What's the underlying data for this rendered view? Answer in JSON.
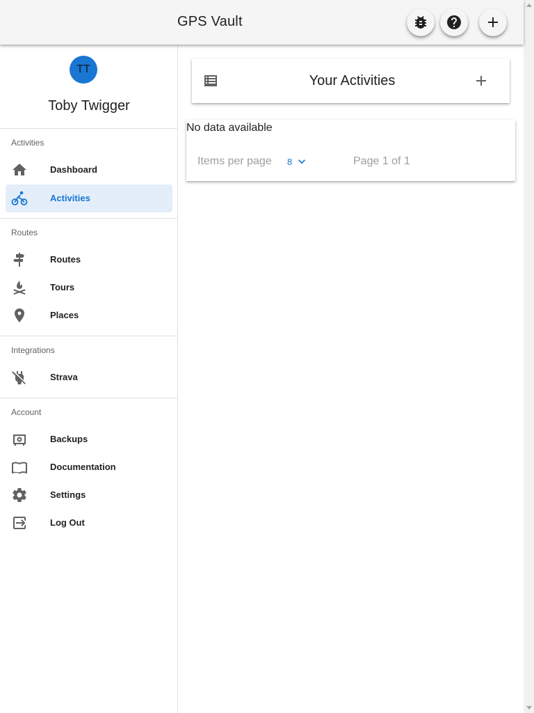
{
  "app": {
    "title": "GPS Vault"
  },
  "appbar": {
    "actions": [
      {
        "name": "bug-report-button",
        "icon": "bug-icon"
      },
      {
        "name": "help-button",
        "icon": "help-icon"
      },
      {
        "name": "add-button",
        "icon": "plus-icon"
      }
    ]
  },
  "user": {
    "initials": "TT",
    "name": "Toby Twigger"
  },
  "sidebar": {
    "sections": [
      {
        "title": "Activities",
        "items": [
          {
            "label": "Dashboard",
            "icon": "home-icon",
            "active": false
          },
          {
            "label": "Activities",
            "icon": "bike-icon",
            "active": true
          }
        ]
      },
      {
        "title": "Routes",
        "items": [
          {
            "label": "Routes",
            "icon": "signpost-icon",
            "active": false
          },
          {
            "label": "Tours",
            "icon": "campfire-icon",
            "active": false
          },
          {
            "label": "Places",
            "icon": "map-marker-icon",
            "active": false
          }
        ]
      },
      {
        "title": "Integrations",
        "items": [
          {
            "label": "Strava",
            "icon": "power-plug-off-icon",
            "active": false
          }
        ]
      },
      {
        "title": "Account",
        "items": [
          {
            "label": "Backups",
            "icon": "safe-icon",
            "active": false
          },
          {
            "label": "Documentation",
            "icon": "book-open-icon",
            "active": false
          },
          {
            "label": "Settings",
            "icon": "gear-icon",
            "active": false
          },
          {
            "label": "Log Out",
            "icon": "logout-icon",
            "active": false
          }
        ]
      }
    ]
  },
  "main": {
    "title": "Your Activities",
    "table": {
      "empty_text": "No data available",
      "items_per_page_label": "Items per page",
      "items_per_page_value": "8",
      "page_info": "Page 1 of 1"
    }
  },
  "colors": {
    "accent": "#1976d2",
    "active_bg": "#e3eefa",
    "appbar_bg": "#f5f5f5"
  }
}
